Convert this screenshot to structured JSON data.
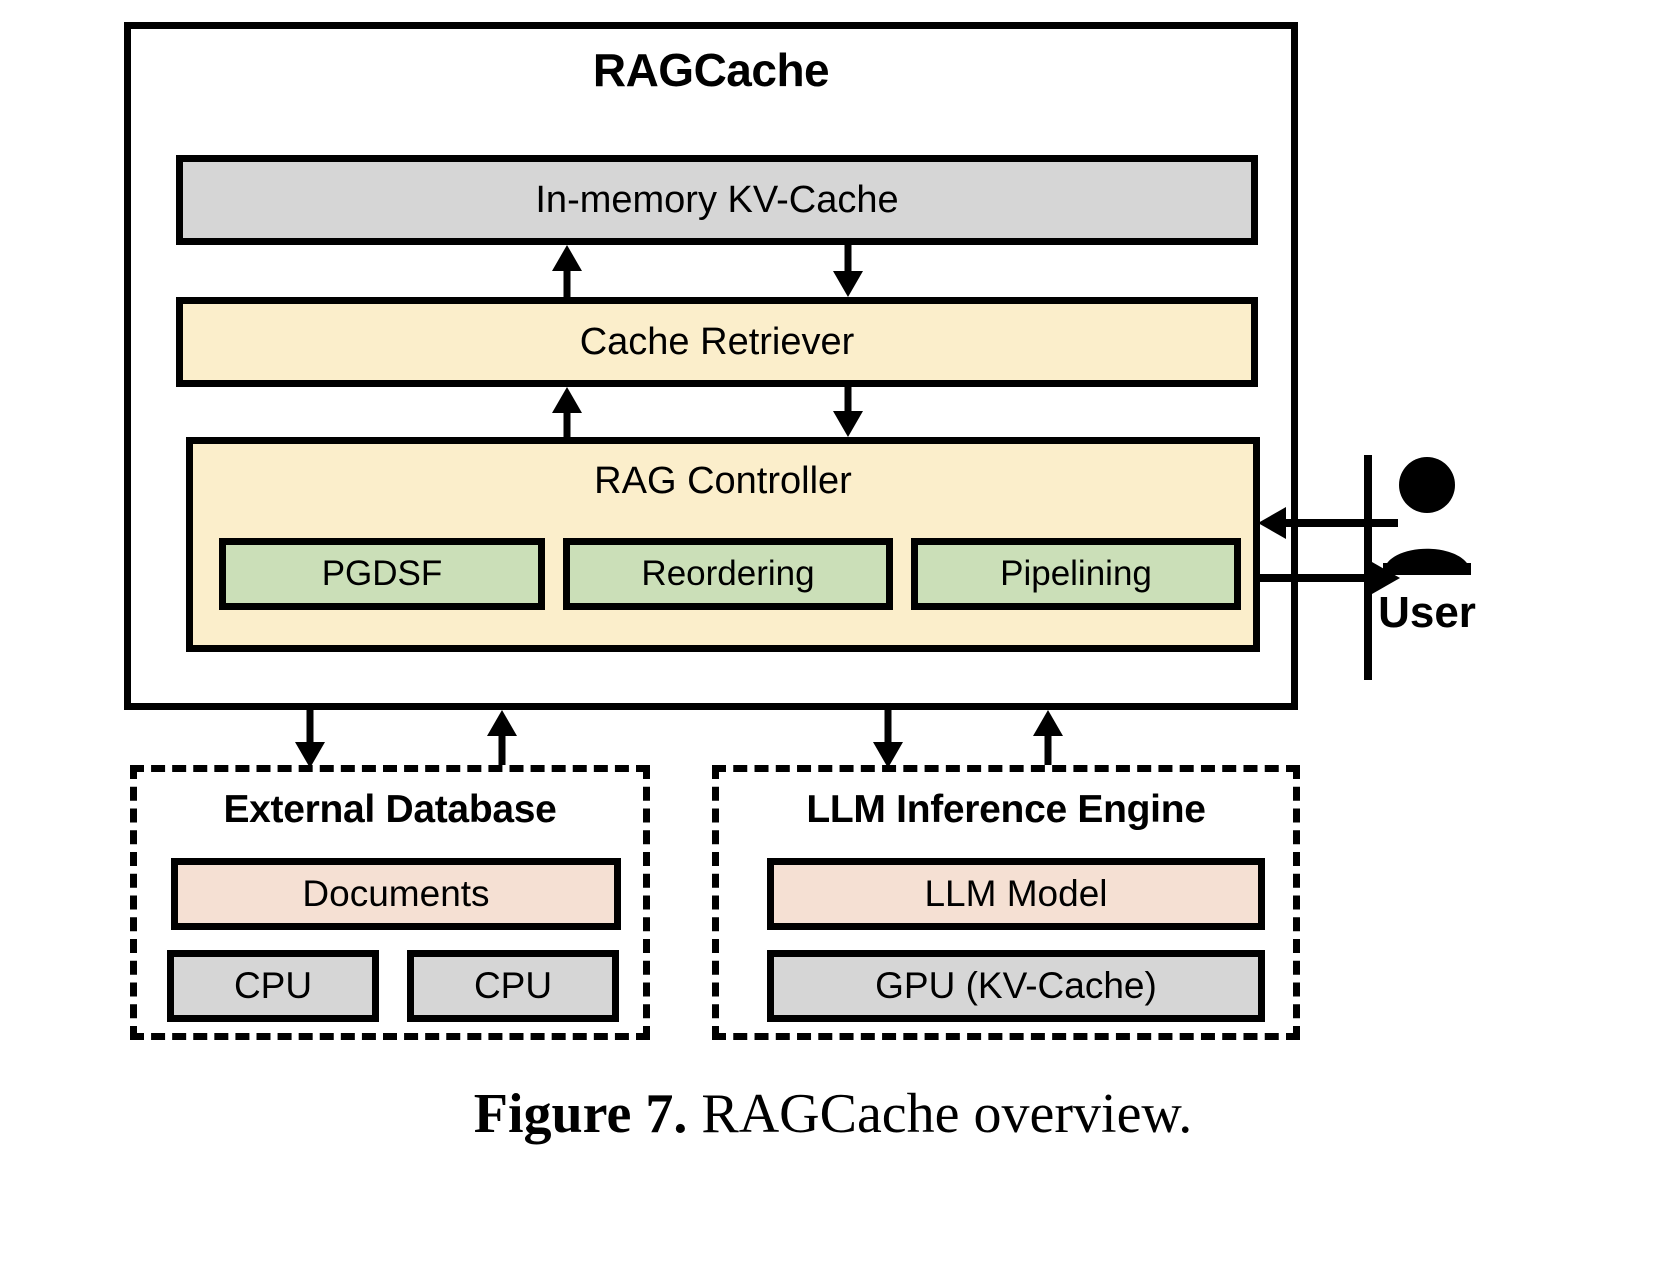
{
  "figure": {
    "caption_label": "Figure 7.",
    "caption_text": "RAGCache overview."
  },
  "diagram": {
    "title": "RAGCache",
    "layers": {
      "kv_cache": "In-memory KV-Cache",
      "cache_retriever": "Cache Retriever",
      "rag_controller": "RAG Controller"
    },
    "controller_modules": [
      {
        "label": "PGDSF"
      },
      {
        "label": "Reordering"
      },
      {
        "label": "Pipelining"
      }
    ],
    "user": {
      "label": "User",
      "icon": "person-icon"
    },
    "external_database": {
      "title": "External Database",
      "items": [
        {
          "label": "Documents"
        },
        {
          "label": "CPU"
        },
        {
          "label": "CPU"
        }
      ]
    },
    "llm_inference_engine": {
      "title": "LLM Inference Engine",
      "items": [
        {
          "label": "LLM Model"
        },
        {
          "label": "GPU (KV-Cache)"
        }
      ]
    },
    "colors": {
      "gray_fill": "#d6d6d6",
      "cream_fill": "#fbeecb",
      "green_fill": "#cbdfb8",
      "peach_fill": "#f5e0d3",
      "stroke": "#000000",
      "background": "#ffffff"
    }
  }
}
